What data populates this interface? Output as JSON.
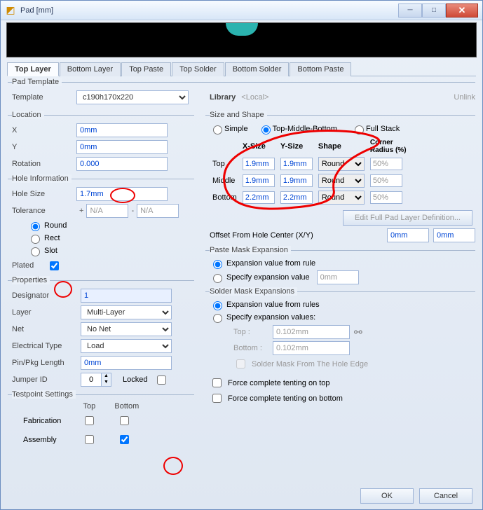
{
  "window": {
    "title": "Pad [mm]"
  },
  "win_buttons": {
    "min": "─",
    "max": "□",
    "close": "✕"
  },
  "tabs": {
    "top_layer": "Top Layer",
    "bottom_layer": "Bottom Layer",
    "top_paste": "Top Paste",
    "top_solder": "Top Solder",
    "bottom_solder": "Bottom Solder",
    "bottom_paste": "Bottom Paste"
  },
  "pad_template": {
    "group": "Pad Template",
    "template_label": "Template",
    "template_value": "c190h170x220",
    "library_label": "Library",
    "library_value": "<Local>",
    "unlink": "Unlink"
  },
  "location": {
    "group": "Location",
    "x_label": "X",
    "x_value": "0mm",
    "y_label": "Y",
    "y_value": "0mm",
    "rotation_label": "Rotation",
    "rotation_value": "0.000"
  },
  "hole_info": {
    "group": "Hole Information",
    "hole_size_label": "Hole Size",
    "hole_size_value": "1.7mm",
    "tolerance_label": "Tolerance",
    "tol_plus": "+",
    "tol_plus_value": "N/A",
    "tol_minus": "-",
    "tol_minus_value": "N/A",
    "shape_round": "Round",
    "shape_rect": "Rect",
    "shape_slot": "Slot",
    "plated_label": "Plated"
  },
  "properties": {
    "group": "Properties",
    "designator_label": "Designator",
    "designator_value": "1",
    "layer_label": "Layer",
    "layer_value": "Multi-Layer",
    "net_label": "Net",
    "net_value": "No Net",
    "elec_type_label": "Electrical Type",
    "elec_type_value": "Load",
    "pin_pkg_label": "Pin/Pkg Length",
    "pin_pkg_value": "0mm",
    "jumper_id_label": "Jumper ID",
    "jumper_id_value": "0",
    "locked_label": "Locked"
  },
  "testpoint": {
    "group": "Testpoint Settings",
    "top": "Top",
    "bottom": "Bottom",
    "fabrication": "Fabrication",
    "assembly": "Assembly"
  },
  "size_shape": {
    "group": "Size and Shape",
    "mode_simple": "Simple",
    "mode_tmb": "Top-Middle-Bottom",
    "mode_full": "Full Stack",
    "col_xsize": "X-Size",
    "col_ysize": "Y-Size",
    "col_shape": "Shape",
    "col_corner": "Corner Radius (%)",
    "row_top": "Top",
    "row_mid": "Middle",
    "row_bot": "Bottom",
    "top_x": "1.9mm",
    "top_y": "1.9mm",
    "top_shape": "Round",
    "top_cr": "50%",
    "mid_x": "1.9mm",
    "mid_y": "1.9mm",
    "mid_shape": "Round",
    "mid_cr": "50%",
    "bot_x": "2.2mm",
    "bot_y": "2.2mm",
    "bot_shape": "Round",
    "bot_cr": "50%",
    "edit_full": "Edit Full Pad Layer Definition...",
    "offset_label": "Offset From Hole Center (X/Y)",
    "offset_x": "0mm",
    "offset_y": "0mm"
  },
  "paste_mask": {
    "group": "Paste Mask Expansion",
    "from_rule": "Expansion value from rule",
    "specify": "Specify expansion value",
    "specify_value": "0mm"
  },
  "solder_mask": {
    "group": "Solder Mask Expansions",
    "from_rules": "Expansion value from rules",
    "specify": "Specify expansion values:",
    "top_label": "Top :",
    "top_value": "0.102mm",
    "bottom_label": "Bottom :",
    "bottom_value": "0.102mm",
    "from_hole_edge": "Solder Mask From The Hole Edge",
    "force_top": "Force complete tenting on top",
    "force_bottom": "Force complete tenting on bottom"
  },
  "footer": {
    "ok": "OK",
    "cancel": "Cancel"
  }
}
